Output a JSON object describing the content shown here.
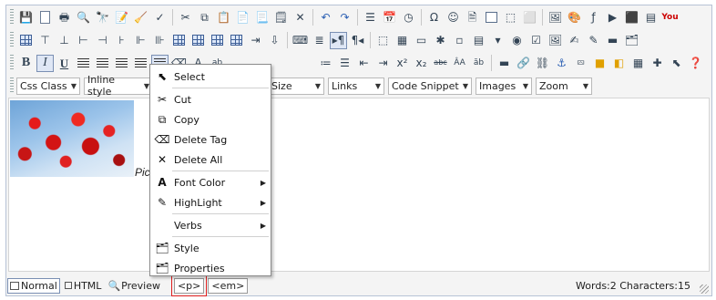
{
  "toolbar": {
    "dropdowns": [
      {
        "label": "Css Class"
      },
      {
        "label": "Inline style"
      },
      {
        "label": ""
      },
      {
        "label": "t"
      },
      {
        "label": "Size"
      },
      {
        "label": "Links"
      },
      {
        "label": "Code Snippet"
      },
      {
        "label": "Images"
      },
      {
        "label": "Zoom"
      }
    ],
    "bold_label": "B",
    "italic_label": "I",
    "underline_label": "U"
  },
  "content": {
    "caption": "Pict"
  },
  "context_menu": {
    "items": [
      {
        "label": "Select",
        "icon": "cursor-icon"
      },
      {
        "label": "Cut",
        "icon": "scissors-icon"
      },
      {
        "label": "Copy",
        "icon": "copy-icon"
      },
      {
        "label": "Delete Tag",
        "icon": "eraser-icon"
      },
      {
        "label": "Delete All",
        "icon": "delete-x-icon"
      },
      {
        "label": "Font Color",
        "icon": "font-color-icon",
        "submenu": true
      },
      {
        "label": "HighLight",
        "icon": "highlight-icon",
        "submenu": true
      },
      {
        "label": "Verbs",
        "icon": "",
        "submenu": true
      },
      {
        "label": "Style",
        "icon": "style-icon"
      },
      {
        "label": "Properties",
        "icon": "properties-icon"
      }
    ]
  },
  "statusbar": {
    "modes": [
      {
        "label": "Normal",
        "active": true
      },
      {
        "label": "HTML",
        "active": false
      },
      {
        "label": "Preview",
        "active": false
      }
    ],
    "tags": [
      "<p>",
      "<em>"
    ],
    "counts": "Words:2 Characters:15"
  }
}
